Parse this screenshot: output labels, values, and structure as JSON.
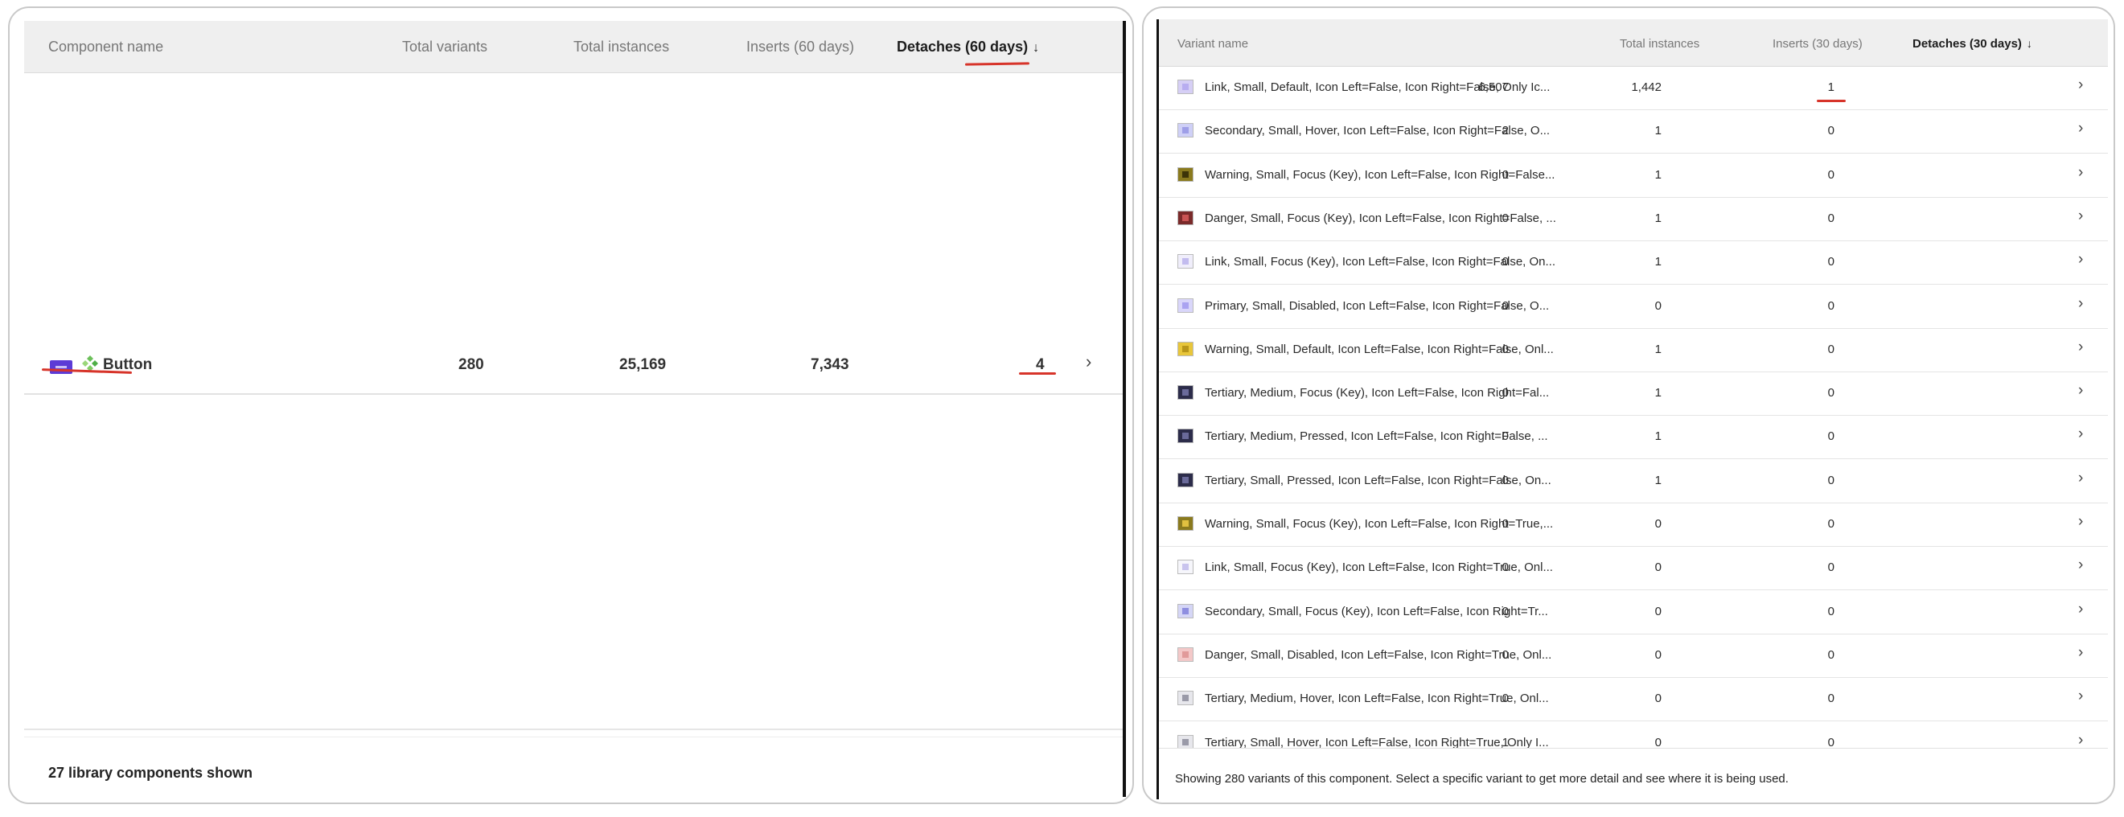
{
  "left": {
    "headers": {
      "component_name": "Component name",
      "total_variants": "Total variants",
      "total_instances": "Total instances",
      "inserts": "Inserts (60 days)",
      "detaches": "Detaches (60 days)",
      "sort_arrow": "↓"
    },
    "row": {
      "name": "Button",
      "total_variants": "280",
      "total_instances": "25,169",
      "inserts": "7,343",
      "detaches": "4",
      "chevron": "›"
    },
    "footer": "27 library components shown"
  },
  "right": {
    "headers": {
      "variant_name": "Variant name",
      "total_instances": "Total instances",
      "inserts": "Inserts (30 days)",
      "detaches": "Detaches (30 days)",
      "sort_arrow": "↓"
    },
    "rows": [
      {
        "name": "Link, Small, Default, Icon Left=False, Icon Right=False, Only Ic...",
        "total": "6,507",
        "inserts": "1,442",
        "detaches": "1",
        "swatch": "#d6cff5",
        "swatch_inner": "#b8adf0",
        "chevron": "›"
      },
      {
        "name": "Secondary, Small, Hover, Icon Left=False, Icon Right=False, O...",
        "total": "2",
        "inserts": "1",
        "detaches": "0",
        "swatch": "#cfd0f7",
        "swatch_inner": "#9f9fe8",
        "chevron": "›"
      },
      {
        "name": "Warning, Small, Focus (Key), Icon Left=False, Icon Right=False...",
        "total": "0",
        "inserts": "1",
        "detaches": "0",
        "swatch": "#8a7a1e",
        "swatch_inner": "#3d3408",
        "chevron": "›"
      },
      {
        "name": "Danger, Small, Focus (Key), Icon Left=False, Icon Right=False, ...",
        "total": "0",
        "inserts": "1",
        "detaches": "0",
        "swatch": "#7a2a2a",
        "swatch_inner": "#c95454",
        "chevron": "›"
      },
      {
        "name": "Link, Small, Focus (Key), Icon Left=False, Icon Right=False, On...",
        "total": "0",
        "inserts": "1",
        "detaches": "0",
        "swatch": "#f0eefb",
        "swatch_inner": "#c3bcef",
        "chevron": "›"
      },
      {
        "name": "Primary, Small, Disabled, Icon Left=False, Icon Right=False, O...",
        "total": "0",
        "inserts": "0",
        "detaches": "0",
        "swatch": "#d9d6fa",
        "swatch_inner": "#aaa3f1",
        "chevron": "›"
      },
      {
        "name": "Warning, Small, Default, Icon Left=False, Icon Right=False, Onl...",
        "total": "0",
        "inserts": "1",
        "detaches": "0",
        "swatch": "#e8c63a",
        "swatch_inner": "#b8961a",
        "chevron": "›"
      },
      {
        "name": "Tertiary, Medium, Focus (Key), Icon Left=False, Icon Right=Fal...",
        "total": "0",
        "inserts": "1",
        "detaches": "0",
        "swatch": "#2c2c4a",
        "swatch_inner": "#6a6a9a",
        "chevron": "›"
      },
      {
        "name": "Tertiary, Medium, Pressed, Icon Left=False, Icon Right=False, ...",
        "total": "0",
        "inserts": "1",
        "detaches": "0",
        "swatch": "#2c2c4a",
        "swatch_inner": "#6a6a9a",
        "chevron": "›"
      },
      {
        "name": "Tertiary, Small, Pressed, Icon Left=False, Icon Right=False, On...",
        "total": "0",
        "inserts": "1",
        "detaches": "0",
        "swatch": "#2c2c4a",
        "swatch_inner": "#6a6a9a",
        "chevron": "›"
      },
      {
        "name": "Warning, Small, Focus (Key), Icon Left=False, Icon Right=True,...",
        "total": "0",
        "inserts": "0",
        "detaches": "0",
        "swatch": "#8a7a1e",
        "swatch_inner": "#e0c040",
        "chevron": "›"
      },
      {
        "name": "Link, Small, Focus (Key), Icon Left=False, Icon Right=True, Onl...",
        "total": "0",
        "inserts": "0",
        "detaches": "0",
        "swatch": "#f6f6fb",
        "swatch_inner": "#c9c4ee",
        "chevron": "›"
      },
      {
        "name": "Secondary, Small, Focus (Key), Icon Left=False, Icon Right=Tr...",
        "total": "0",
        "inserts": "0",
        "detaches": "0",
        "swatch": "#d5d6f6",
        "swatch_inner": "#8f8fe0",
        "chevron": "›"
      },
      {
        "name": "Danger, Small, Disabled, Icon Left=False, Icon Right=True, Onl...",
        "total": "0",
        "inserts": "0",
        "detaches": "0",
        "swatch": "#f3c8c8",
        "swatch_inner": "#e19a9a",
        "chevron": "›"
      },
      {
        "name": "Tertiary, Medium, Hover, Icon Left=False, Icon Right=True, Onl...",
        "total": "0",
        "inserts": "0",
        "detaches": "0",
        "swatch": "#e7e7ec",
        "swatch_inner": "#9a9aa8",
        "chevron": "›"
      },
      {
        "name": "Tertiary, Small, Hover, Icon Left=False, Icon Right=True, Only I...",
        "total": "1",
        "inserts": "0",
        "detaches": "0",
        "swatch": "#e7e7ec",
        "swatch_inner": "#9a9aa8",
        "chevron": "›"
      }
    ],
    "footer": "Showing 280 variants of this component. Select a specific variant to get more detail and see where it is being used."
  },
  "colors": {
    "annotation_red": "#d7342a",
    "button_thumb": "#5c3bd6",
    "header_bg": "#efefef"
  }
}
